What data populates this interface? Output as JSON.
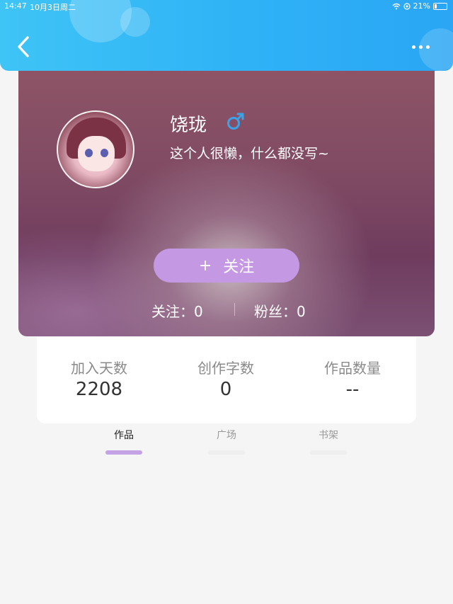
{
  "status_bar": {
    "time": "14:47",
    "date": "10月3日周二",
    "battery": "21%"
  },
  "header": {
    "back_icon": "chevron-left-icon",
    "more_icon": "more-dots-icon",
    "color": "#2fb2f6"
  },
  "profile": {
    "name": "饶珑",
    "gender_icon": "male-icon",
    "bio": "这个人很懒，什么都没写~",
    "follow_button": {
      "icon": "+",
      "label": "关注"
    },
    "following": "关注：0",
    "fans": "粉丝：0"
  },
  "stats": [
    {
      "label": "加入天数",
      "value": "2208"
    },
    {
      "label": "创作字数",
      "value": "0"
    },
    {
      "label": "作品数量",
      "value": "--"
    }
  ],
  "tabs": [
    {
      "label": "作品",
      "active": true
    },
    {
      "label": "广场",
      "active": false
    },
    {
      "label": "书架",
      "active": false
    }
  ],
  "colors": {
    "accent": "#c598e4",
    "tab_active": "#c3a2e6",
    "gender": "#3aa3e8"
  }
}
